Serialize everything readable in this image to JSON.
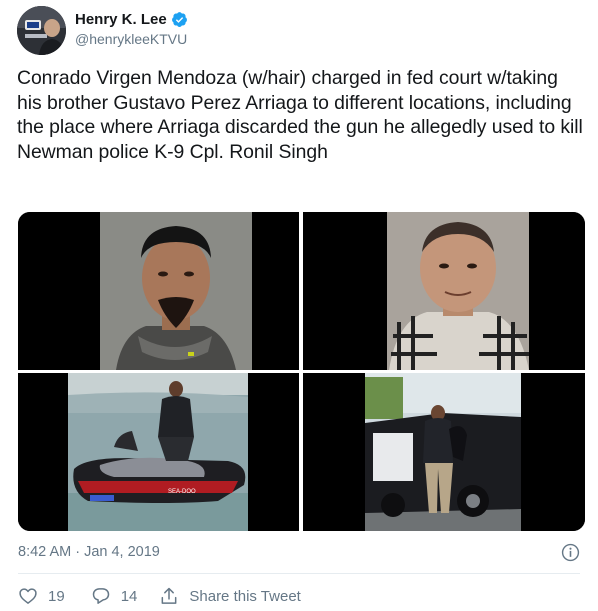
{
  "author": {
    "display_name": "Henry K. Lee",
    "handle": "@henrykleeKTVU",
    "avatar_icon": "avatar-photo",
    "verified_icon": "verified-badge-icon"
  },
  "tweet": {
    "text": "Conrado Virgen Mendoza (w/hair) charged in fed court w/taking his brother Gustavo Perez Arriaga to different locations, including the place where Arriaga discarded the gun he allegedly used to kill Newman police K-9 Cpl. Ronil Singh",
    "timestamp": "8:42 AM · Jan 4, 2019"
  },
  "media": [
    {
      "name": "mugshot-with-hair"
    },
    {
      "name": "mugshot-bald"
    },
    {
      "name": "jet-ski-photo"
    },
    {
      "name": "officer-with-k9-photo"
    }
  ],
  "actions": {
    "like_count": "19",
    "reply_count": "14",
    "share_label": "Share this Tweet"
  },
  "colors": {
    "text": "#14171a",
    "secondary": "#657786",
    "verified": "#1da1f2",
    "divider": "#e6ecf0"
  }
}
